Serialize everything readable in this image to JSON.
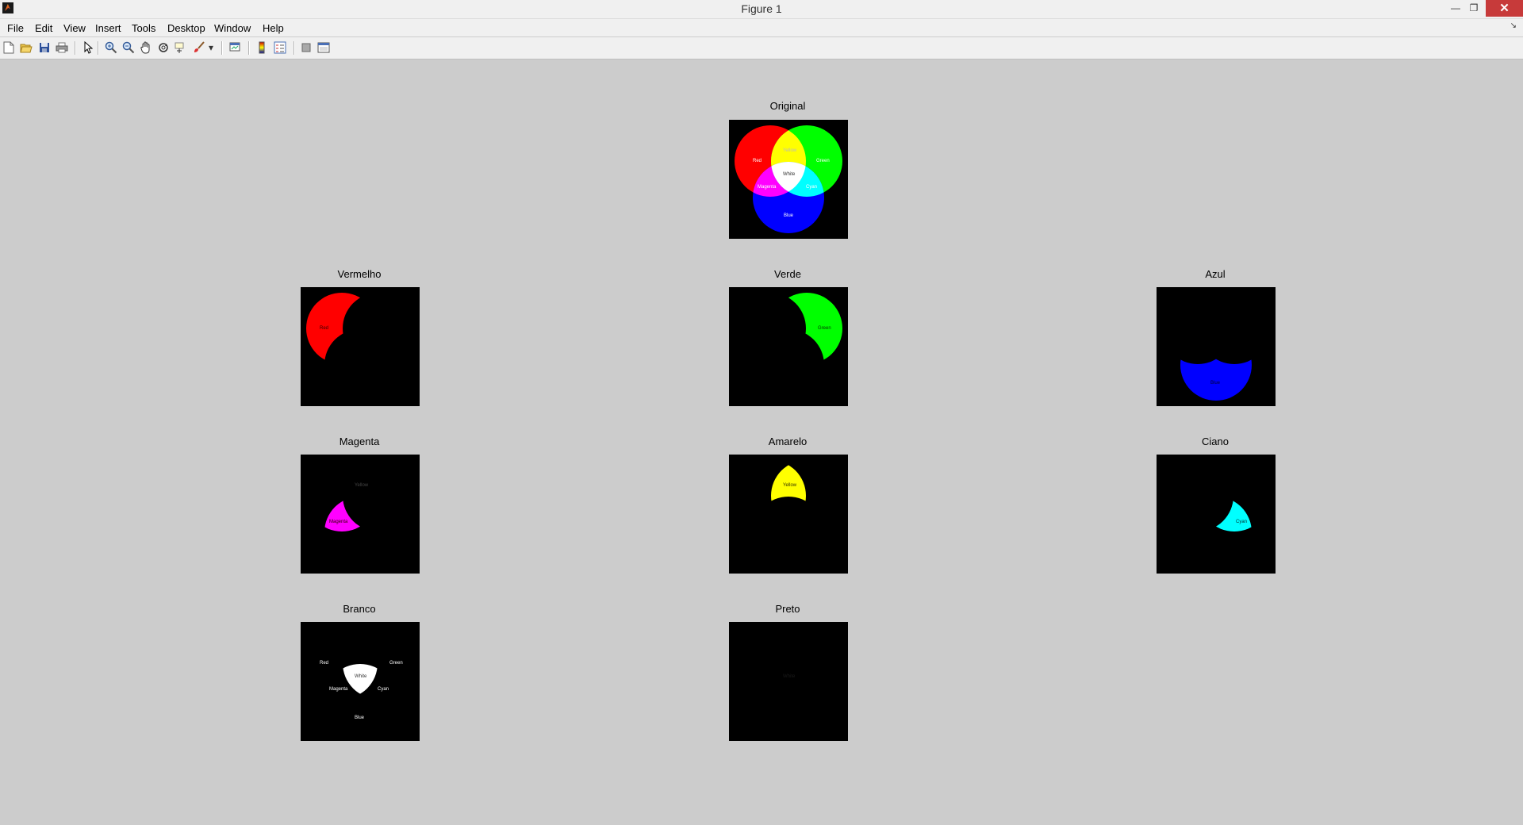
{
  "window": {
    "title": "Figure 1"
  },
  "menu": [
    "File",
    "Edit",
    "View",
    "Insert",
    "Tools",
    "Desktop",
    "Window",
    "Help"
  ],
  "toolbar": {
    "tools": [
      "new-figure-icon",
      "open-file-icon",
      "save-icon",
      "print-icon",
      "pointer-icon",
      "zoom-in-icon",
      "zoom-out-icon",
      "pan-hand-icon",
      "rotate-3d-icon",
      "data-cursor-icon",
      "brush-icon",
      "brush-dropdown-icon",
      "link-plot-icon",
      "colorbar-icon",
      "legend-icon",
      "hide-plot-tools-icon",
      "show-plot-tools-icon"
    ]
  },
  "panels": [
    {
      "title": "Original",
      "channel": "original"
    },
    {
      "title": "Vermelho",
      "channel": "red"
    },
    {
      "title": "Verde",
      "channel": "green"
    },
    {
      "title": "Azul",
      "channel": "blue"
    },
    {
      "title": "Magenta",
      "channel": "magenta"
    },
    {
      "title": "Amarelo",
      "channel": "yellow"
    },
    {
      "title": "Ciano",
      "channel": "cyan"
    },
    {
      "title": "Branco",
      "channel": "white"
    },
    {
      "title": "Preto",
      "channel": "black"
    }
  ],
  "image_labels": {
    "red": "Red",
    "green": "Green",
    "blue": "Blue",
    "yellow": "Yellow",
    "magenta": "Magenta",
    "cyan": "Cyan",
    "white": "White"
  },
  "colors": {
    "red": "#ff0000",
    "green": "#00ff00",
    "blue": "#0000ff",
    "yellow": "#ffff00",
    "magenta": "#ff00ff",
    "cyan": "#00ffff",
    "white": "#ffffff",
    "black": "#000000",
    "figure_bg": "#cccccc"
  }
}
